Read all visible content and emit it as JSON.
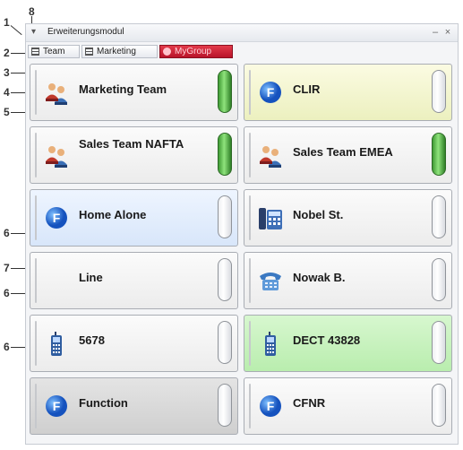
{
  "window": {
    "title": "Erweiterungsmodul"
  },
  "callouts": [
    "1",
    "8",
    "2",
    "3",
    "4",
    "5",
    "6",
    "7",
    "6",
    "6"
  ],
  "tabs": [
    {
      "label": "Team"
    },
    {
      "label": "Marketing"
    },
    {
      "label": "MyGroup"
    }
  ],
  "buttons": [
    {
      "label": "Marketing Team",
      "icon": "team-icon",
      "color": "white",
      "lamp": "on"
    },
    {
      "label": "CLIR",
      "icon": "function-icon",
      "color": "yellow",
      "lamp": "off"
    },
    {
      "label": "Sales Team NAFTA",
      "icon": "team-icon",
      "color": "white",
      "lamp": "on"
    },
    {
      "label": "Sales Team EMEA",
      "icon": "team-icon",
      "color": "white",
      "lamp": "on"
    },
    {
      "label": "Home Alone",
      "icon": "function-icon",
      "color": "blue",
      "lamp": "off"
    },
    {
      "label": "Nobel St.",
      "icon": "desk-phone-icon",
      "color": "white",
      "lamp": "off"
    },
    {
      "label": "Line",
      "icon": "none",
      "color": "white",
      "lamp": "off"
    },
    {
      "label": "Nowak B.",
      "icon": "telephone-icon",
      "color": "white",
      "lamp": "off"
    },
    {
      "label": "5678",
      "icon": "mobile-phone-icon",
      "color": "white",
      "lamp": "off"
    },
    {
      "label": "DECT 43828",
      "icon": "mobile-phone-icon",
      "color": "green",
      "lamp": "off"
    },
    {
      "label": "Function",
      "icon": "function-icon",
      "color": "grey",
      "lamp": "off"
    },
    {
      "label": "CFNR",
      "icon": "function-icon",
      "color": "white",
      "lamp": "off"
    }
  ],
  "colors": {
    "lamp_on": "#5cc24a",
    "tab_active": "#c81e32",
    "button_yellow": "#eef2c4",
    "button_blue": "#dbe8fb",
    "button_green": "#bdeeb2"
  }
}
